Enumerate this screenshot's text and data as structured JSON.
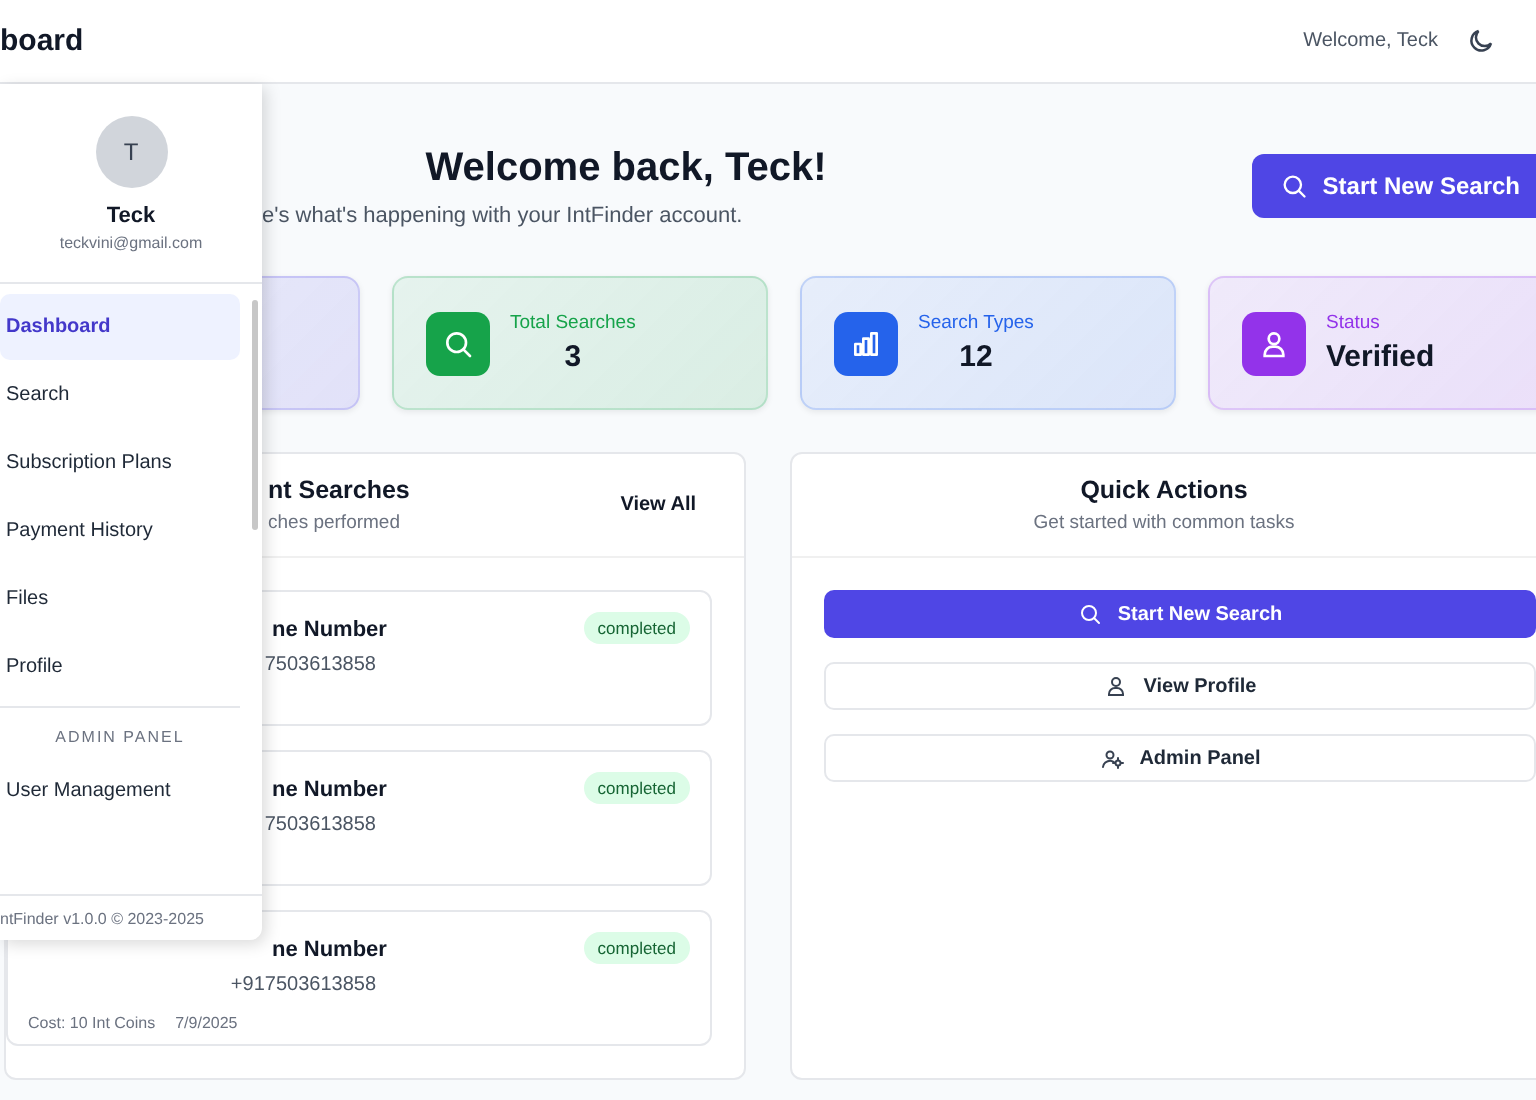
{
  "topbar": {
    "title": "board",
    "greeting": "Welcome, Teck"
  },
  "sidebar": {
    "avatar_initial": "T",
    "name": "Teck",
    "email": "teckvini@gmail.com",
    "items": [
      {
        "label": "Dashboard",
        "selected": true
      },
      {
        "label": "Search",
        "selected": false
      },
      {
        "label": "Subscription Plans",
        "selected": false
      },
      {
        "label": "Payment History",
        "selected": false
      },
      {
        "label": "Files",
        "selected": false
      },
      {
        "label": "Profile",
        "selected": false
      }
    ],
    "section_label": "ADMIN PANEL",
    "admin_items": [
      {
        "label": "User Management",
        "selected": false
      }
    ],
    "footer": "ntFinder v1.0.0 © 2023-2025"
  },
  "hero": {
    "title": "Welcome back, Teck!",
    "subtitle": "e's what's happening with your IntFinder account.",
    "button": "Start New Search"
  },
  "stats": [
    {
      "kind": "covered"
    },
    {
      "kind": "searches",
      "label": "Total Searches",
      "value": "3"
    },
    {
      "kind": "types",
      "label": "Search Types",
      "value": "12"
    },
    {
      "kind": "status",
      "label": "Status",
      "value": "Verified"
    }
  ],
  "recent": {
    "title": "nt Searches",
    "subtitle": "ches performed",
    "link": "View All",
    "items": [
      {
        "title": "ne Number",
        "phone": "7503613858",
        "status": "completed"
      },
      {
        "title": "ne Number",
        "phone": "7503613858",
        "status": "completed"
      },
      {
        "title": "ne Number",
        "phone": "+917503613858",
        "status": "completed",
        "cost": "Cost: 10 Int Coins",
        "date": "7/9/2025"
      }
    ]
  },
  "quick": {
    "title": "Quick Actions",
    "subtitle": "Get started with common tasks",
    "actions": [
      {
        "kind": "primary",
        "label": "Start New Search"
      },
      {
        "kind": "secondary",
        "label": "View Profile"
      },
      {
        "kind": "secondary",
        "label": "Admin Panel"
      }
    ]
  }
}
